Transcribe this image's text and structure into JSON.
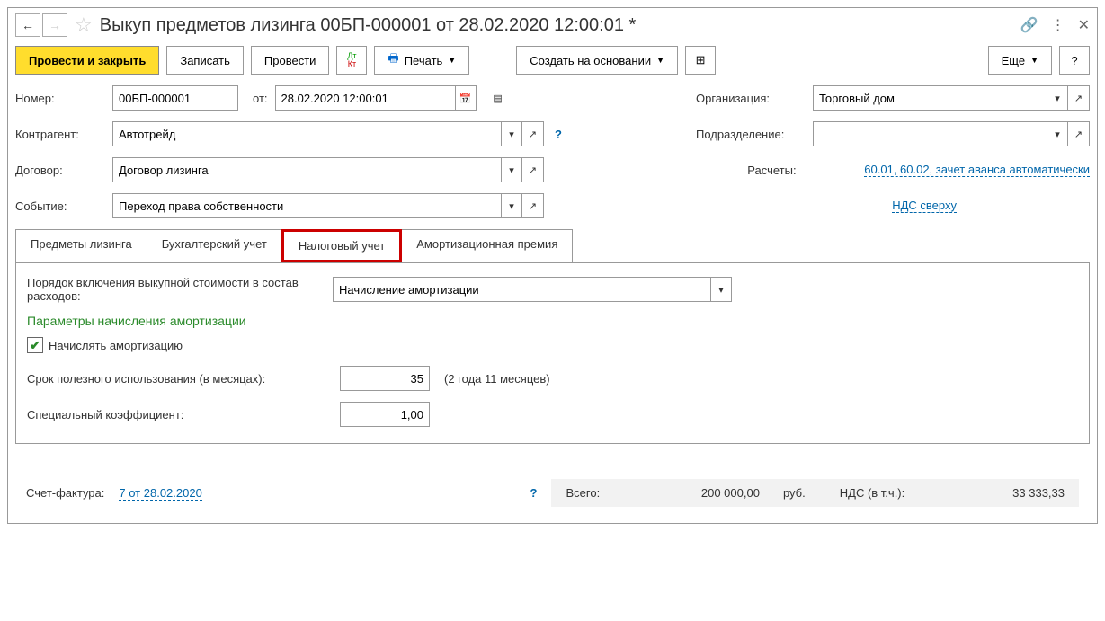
{
  "titlebar": {
    "title": "Выкуп предметов лизинга 00БП-000001 от 28.02.2020 12:00:01 *"
  },
  "toolbar": {
    "post_close": "Провести и закрыть",
    "write": "Записать",
    "post": "Провести",
    "print": "Печать",
    "create_based": "Создать на основании",
    "more": "Еще",
    "help": "?"
  },
  "fields": {
    "number_label": "Номер:",
    "number": "00БП-000001",
    "from_label": "от:",
    "date": "28.02.2020 12:00:01",
    "org_label": "Организация:",
    "org": "Торговый дом",
    "counterparty_label": "Контрагент:",
    "counterparty": "Автотрейд",
    "subdiv_label": "Подразделение:",
    "subdiv": "",
    "contract_label": "Договор:",
    "contract": "Договор лизинга",
    "calc_label": "Расчеты:",
    "calc_link": "60.01, 60.02, зачет аванса автоматически",
    "event_label": "Событие:",
    "event": "Переход права собственности",
    "vat_link": "НДС сверху"
  },
  "tabs": {
    "t1": "Предметы лизинга",
    "t2": "Бухгалтерский учет",
    "t3": "Налоговый учет",
    "t4": "Амортизационная премия"
  },
  "tax_tab": {
    "order_label": "Порядок включения выкупной стоимости в состав расходов:",
    "order_value": "Начисление амортизации",
    "section": "Параметры начисления амортизации",
    "checkbox": "Начислять амортизацию",
    "term_label": "Срок полезного использования (в месяцах):",
    "term_value": "35",
    "term_hint": "(2 года 11 месяцев)",
    "coef_label": "Специальный коэффициент:",
    "coef_value": "1,00"
  },
  "footer": {
    "invoice_label": "Счет-фактура:",
    "invoice_link": "7 от 28.02.2020",
    "total_label": "Всего:",
    "total": "200 000,00",
    "currency": "руб.",
    "vat_label": "НДС (в т.ч.):",
    "vat": "33 333,33"
  }
}
